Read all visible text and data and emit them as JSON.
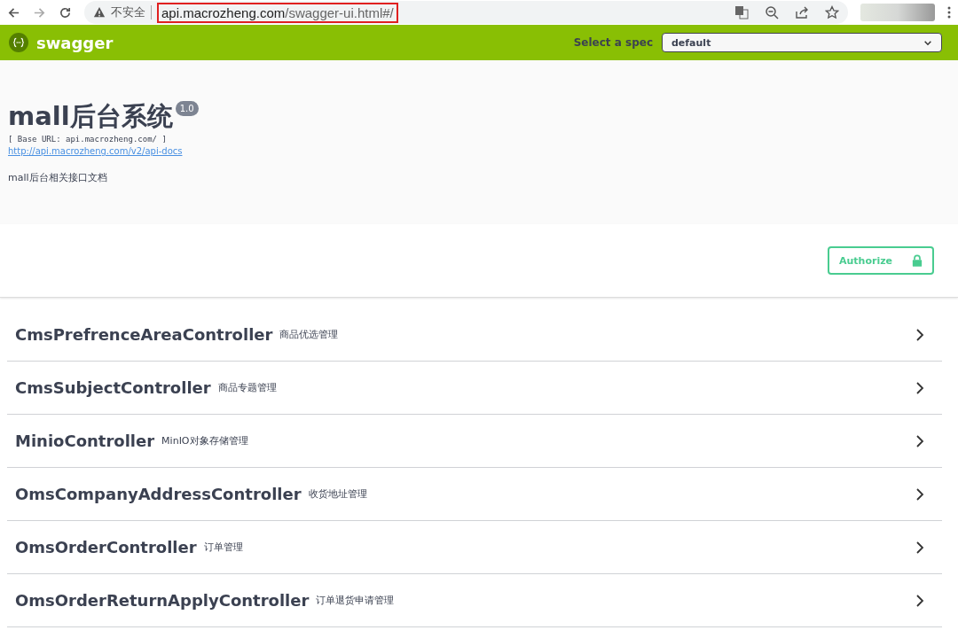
{
  "browser": {
    "security_label": "不安全",
    "url_host": "api.macrozheng.com",
    "url_path": "/swagger-ui.html#/"
  },
  "topbar": {
    "logo_text": "swagger",
    "spec_label": "Select a spec",
    "spec_value": "default"
  },
  "info": {
    "title": "mall后台系统",
    "version": "1.0",
    "base_url": "[ Base URL: api.macrozheng.com/ ]",
    "docs_link": "http://api.macrozheng.com/v2/api-docs",
    "description": "mall后台相关接口文档"
  },
  "authorize_button": "Authorize",
  "tags": [
    {
      "name": "CmsPrefrenceAreaController",
      "description": "商品优选管理",
      "expanded": false
    },
    {
      "name": "CmsSubjectController",
      "description": "商品专题管理",
      "expanded": false
    },
    {
      "name": "MinioController",
      "description": "MinIO对象存储管理",
      "expanded": false
    },
    {
      "name": "OmsCompanyAddressController",
      "description": "收货地址管理",
      "expanded": false
    },
    {
      "name": "OmsOrderController",
      "description": "订单管理",
      "expanded": false
    },
    {
      "name": "OmsOrderReturnApplyController",
      "description": "订单退货申请管理",
      "expanded": false
    }
  ]
}
